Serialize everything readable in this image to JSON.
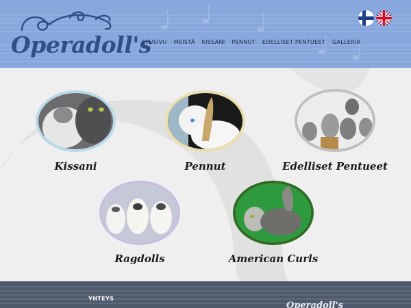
{
  "brand": {
    "name": "Operadoll's"
  },
  "nav": {
    "items": [
      {
        "label": "ETUSIVU"
      },
      {
        "label": "MEISTÄ"
      },
      {
        "label": "KISSANI"
      },
      {
        "label": "PENNUT"
      },
      {
        "label": "EDELLISET PENTUEET"
      },
      {
        "label": "GALLERIA"
      }
    ]
  },
  "languages": [
    {
      "code": "fi",
      "icon": "finnish-flag-icon"
    },
    {
      "code": "en",
      "icon": "uk-flag-icon"
    }
  ],
  "cards": [
    {
      "label": "Kissani",
      "border_color": "#b9dbe9"
    },
    {
      "label": "Pennut",
      "border_color": "#ecdfae"
    },
    {
      "label": "Edelliset Pentueet",
      "border_color": "#bfbfbf"
    },
    {
      "label": "Ragdolls",
      "border_color": "#c7bfe0"
    },
    {
      "label": "American Curls",
      "border_color": "#2f6b22"
    }
  ],
  "footer": {
    "title": "YHTEYS",
    "logo": "Operadoll's"
  },
  "colors": {
    "header_bg": "#87a7dd",
    "footer_bg": "#4e5a6c",
    "page_bg": "#efefef",
    "logo_text": "#2f4f86"
  }
}
